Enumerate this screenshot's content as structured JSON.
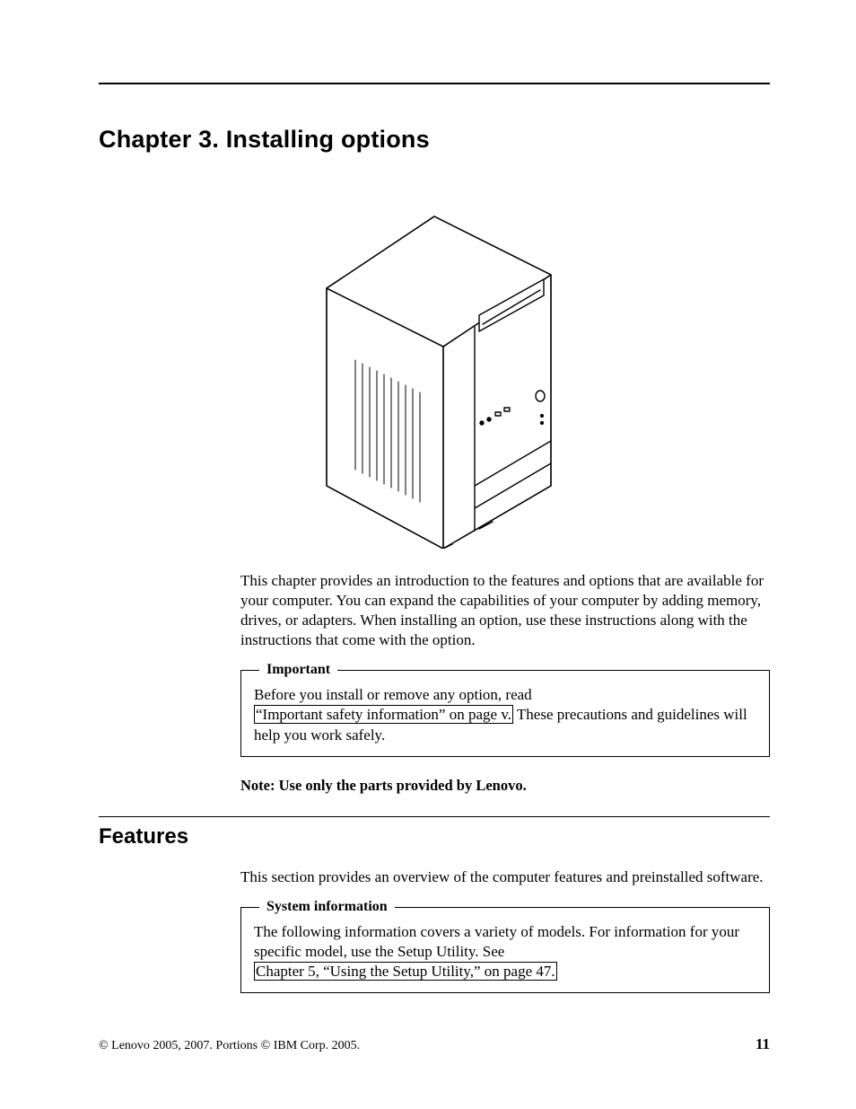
{
  "chapter": {
    "title": "Chapter 3. Installing options",
    "intro": "This chapter provides an introduction to the features and options that are available for your computer. You can expand the capabilities of your computer by adding memory, drives, or adapters. When installing an option, use these instructions along with the instructions that come with the option."
  },
  "important": {
    "legend": "Important",
    "before": "Before you install or remove any option, read ",
    "link": "“Important safety information” on page v.",
    "after": " These precautions and guidelines will help you work safely."
  },
  "note": "Note:  Use only the parts provided by Lenovo.",
  "features": {
    "title": "Features",
    "intro": "This section provides an overview of the computer features and preinstalled software."
  },
  "sysinfo": {
    "legend": "System information",
    "before": "The following information covers a variety of models. For information for your specific model, use the Setup Utility. See ",
    "link": "Chapter 5, “Using the Setup Utility,” on page 47.",
    "after": ""
  },
  "footer": {
    "copyright": "© Lenovo 2005, 2007. Portions © IBM Corp. 2005.",
    "page": "11"
  }
}
